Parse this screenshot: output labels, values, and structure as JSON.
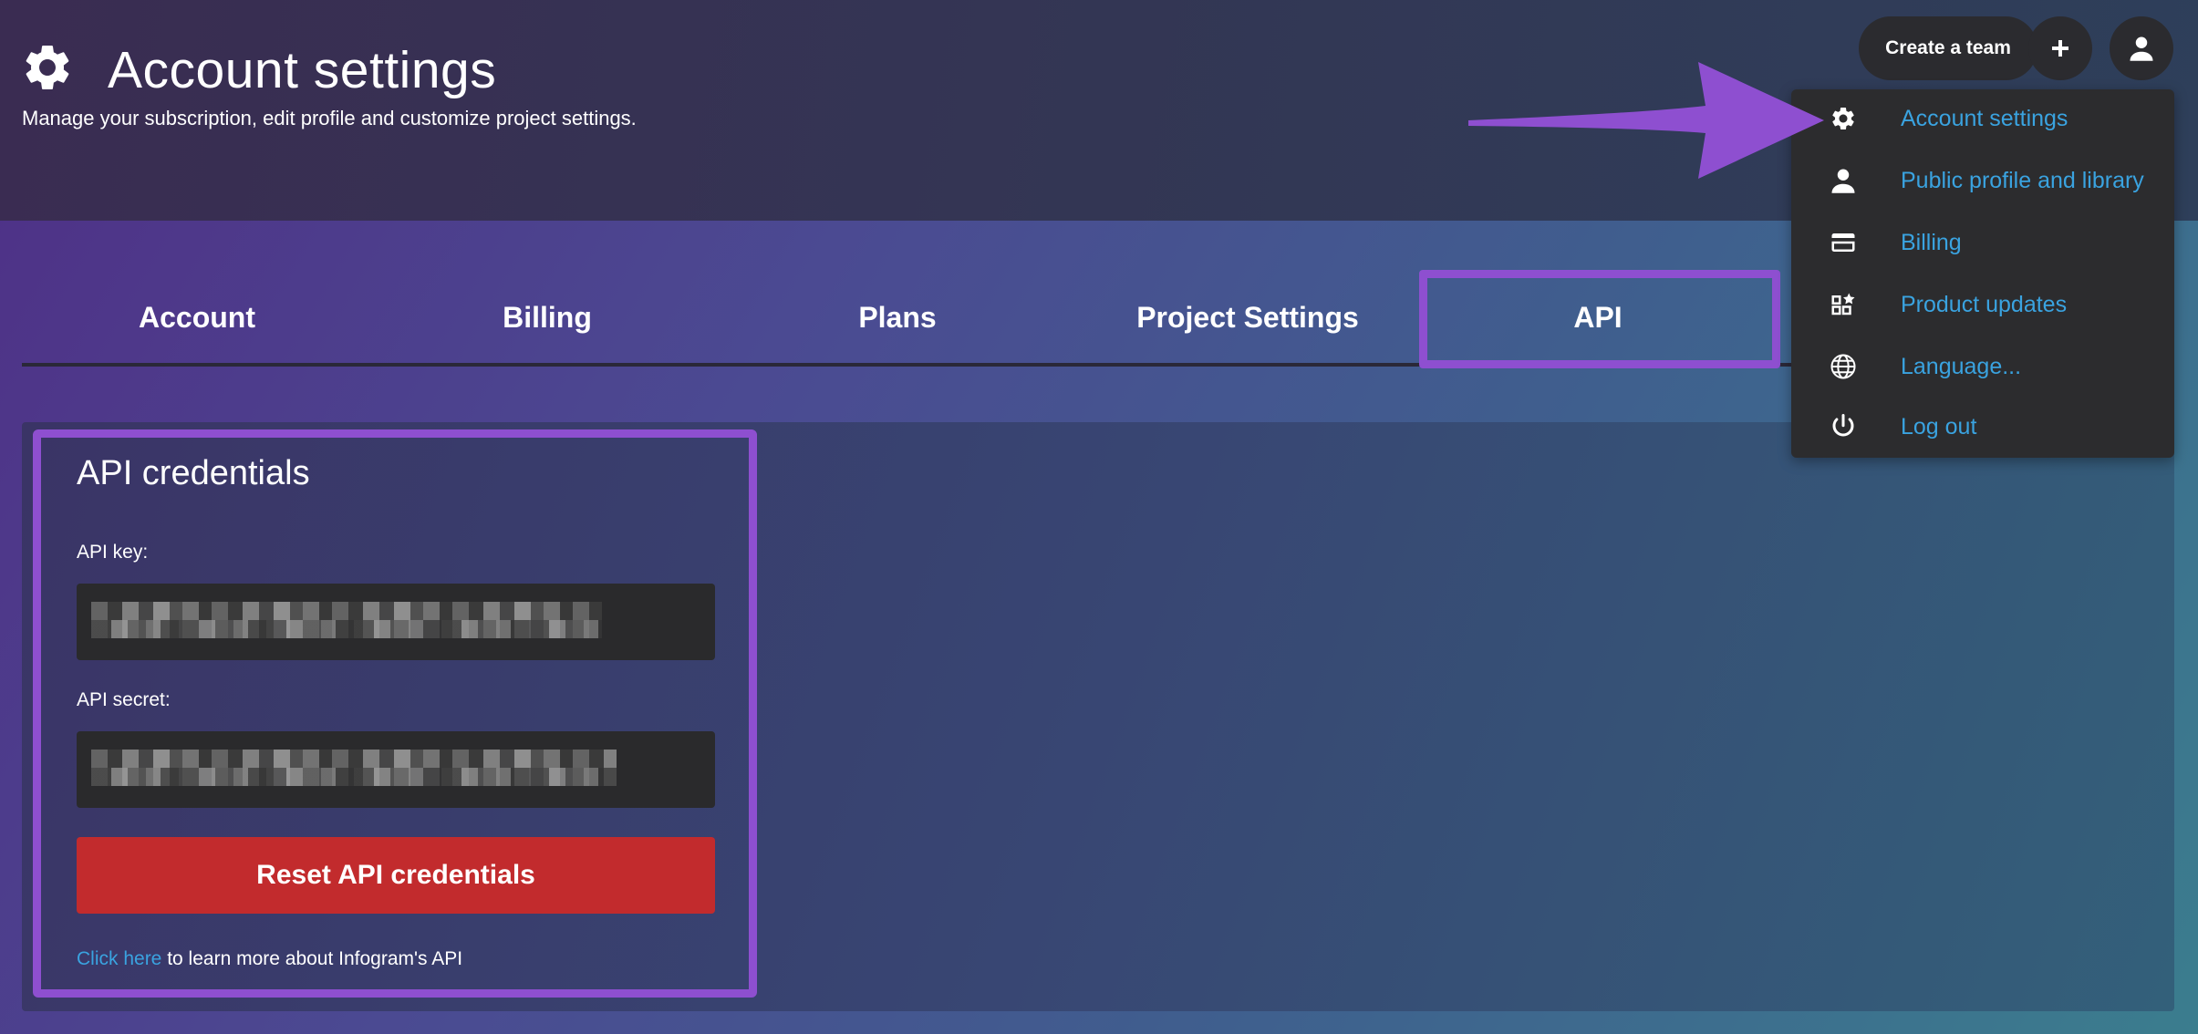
{
  "header": {
    "title": "Account settings",
    "subtitle": "Manage your subscription, edit profile and customize project settings.",
    "icon": "gear-icon"
  },
  "topbar": {
    "create_team_label": "Create a team",
    "plus_icon": "plus-icon",
    "avatar_icon": "user-icon"
  },
  "tabs": [
    {
      "label": "Account"
    },
    {
      "label": "Billing"
    },
    {
      "label": "Plans"
    },
    {
      "label": "Project Settings"
    },
    {
      "label": "API",
      "active": true
    }
  ],
  "api": {
    "heading": "API credentials",
    "key_label": "API key:",
    "secret_label": "API secret:",
    "reset_label": "Reset API credentials",
    "learn_link": "Click here",
    "learn_text": " to learn more about Infogram's API"
  },
  "dropdown": {
    "items": [
      {
        "label": "Account settings",
        "icon": "gear-icon"
      },
      {
        "label": "Public profile and library",
        "icon": "user-icon"
      },
      {
        "label": "Billing",
        "icon": "credit-card-icon"
      },
      {
        "label": "Product updates",
        "icon": "product-updates-icon"
      },
      {
        "label": "Language...",
        "icon": "globe-icon"
      },
      {
        "label": "Log out",
        "icon": "power-icon"
      }
    ]
  },
  "colors": {
    "accent_highlight": "#8e4fd0",
    "link": "#3aa3e0",
    "danger": "#c22b2d",
    "dark_surface": "#2b2b2f"
  }
}
